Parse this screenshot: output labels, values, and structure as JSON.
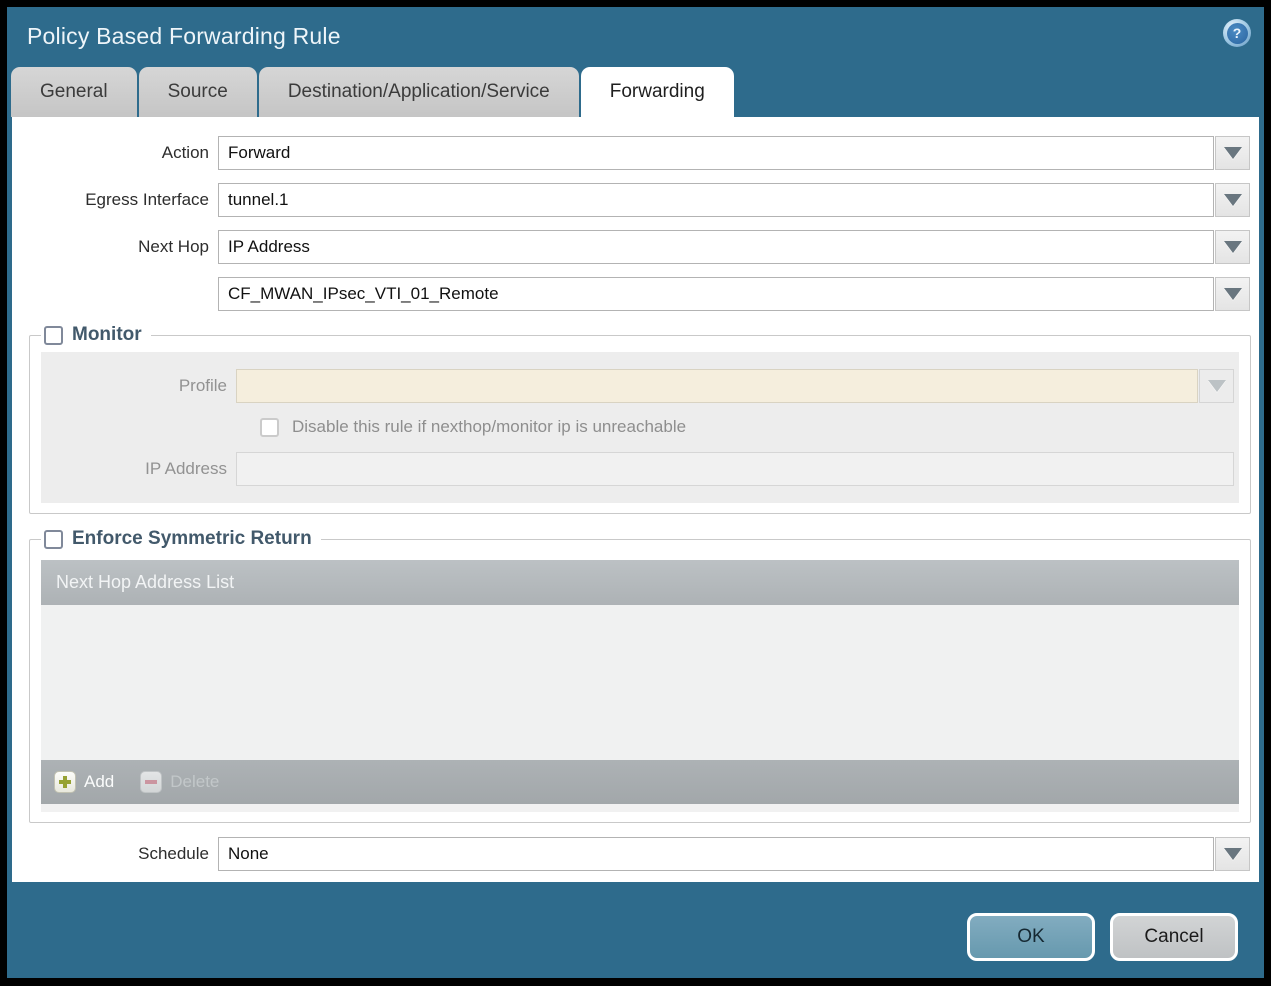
{
  "dialog": {
    "title": "Policy Based Forwarding Rule"
  },
  "tabs": [
    {
      "label": "General",
      "active": false
    },
    {
      "label": "Source",
      "active": false
    },
    {
      "label": "Destination/Application/Service",
      "active": false
    },
    {
      "label": "Forwarding",
      "active": true
    }
  ],
  "form": {
    "action": {
      "label": "Action",
      "value": "Forward"
    },
    "egress_interface": {
      "label": "Egress Interface",
      "value": "tunnel.1"
    },
    "next_hop": {
      "label": "Next Hop",
      "value": "IP Address"
    },
    "next_hop_address": {
      "value": "CF_MWAN_IPsec_VTI_01_Remote"
    },
    "schedule": {
      "label": "Schedule",
      "value": "None"
    }
  },
  "monitor": {
    "title": "Monitor",
    "checked": false,
    "profile": {
      "label": "Profile",
      "value": ""
    },
    "disable_rule": {
      "label": "Disable this rule if nexthop/monitor ip is unreachable",
      "checked": false
    },
    "ip_address": {
      "label": "IP Address",
      "value": ""
    }
  },
  "symmetric_return": {
    "title": "Enforce Symmetric Return",
    "checked": false,
    "table": {
      "header": "Next Hop Address List",
      "rows": []
    },
    "add_label": "Add",
    "delete_label": "Delete"
  },
  "footer": {
    "ok_label": "OK",
    "cancel_label": "Cancel"
  },
  "icons": {
    "help": "help-icon",
    "dropdown": "chevron-down-icon",
    "add": "plus-icon",
    "delete": "minus-icon"
  },
  "colors": {
    "titlebar": "#2e6b8c",
    "section_title": "#42596b",
    "disabled_profile_field": "#f5eedd",
    "table_header": "#b4b9bc",
    "ok_button": "#74a5ba",
    "cancel_button": "#c9cccd"
  }
}
